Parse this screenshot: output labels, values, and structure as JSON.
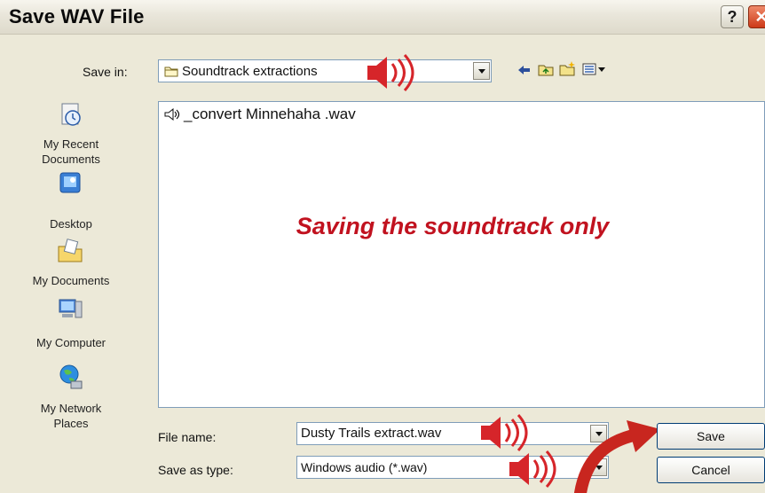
{
  "dialog": {
    "title": "Save WAV File",
    "help_glyph": "?",
    "close_glyph": "✕"
  },
  "save_in": {
    "label": "Save in:",
    "value": "Soundtrack extractions"
  },
  "places": [
    {
      "label": "My Recent Documents",
      "icon": "recent-documents-icon"
    },
    {
      "label": "Desktop",
      "icon": "desktop-icon"
    },
    {
      "label": "My Documents",
      "icon": "my-documents-icon"
    },
    {
      "label": "My Computer",
      "icon": "my-computer-icon"
    },
    {
      "label": "My Network Places",
      "icon": "network-places-icon"
    }
  ],
  "files": [
    {
      "name": "_convert Minnehaha .wav",
      "icon": "audio-file-icon"
    }
  ],
  "annotation": "Saving the soundtrack only",
  "file_name": {
    "label": "File name:",
    "value": "Dusty Trails extract.wav"
  },
  "save_as_type": {
    "label": "Save as type:",
    "value": "Windows audio (*.wav)"
  },
  "buttons": {
    "save": "Save",
    "cancel": "Cancel"
  },
  "colors": {
    "annotation": "#c1121f",
    "speaker_icon": "#d6252a",
    "arrow": "#c8261f"
  }
}
